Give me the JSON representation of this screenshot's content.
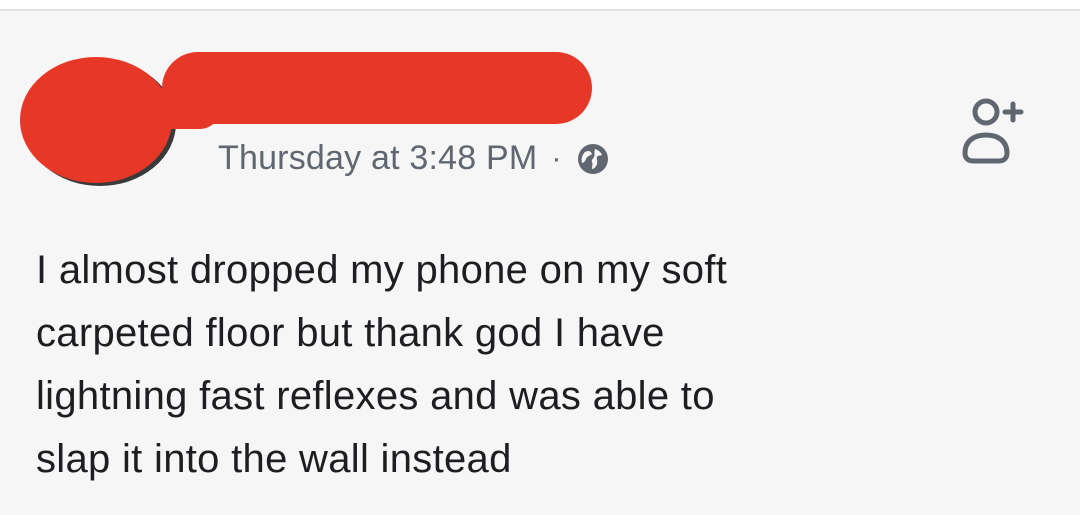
{
  "post": {
    "timestamp": "Thursday at 3:48 PM",
    "separator": "·",
    "privacy_icon": "globe-icon",
    "action_icon": "add-friend-icon",
    "text_lines": [
      "I almost dropped my phone on my soft",
      "carpeted floor but thank god I have",
      "lightning fast reflexes and was able to",
      "slap it into the wall instead"
    ]
  },
  "colors": {
    "redaction": "#e73827",
    "meta_text": "#606770",
    "body_text": "#1c1e21",
    "background": "#f6f6f6"
  }
}
